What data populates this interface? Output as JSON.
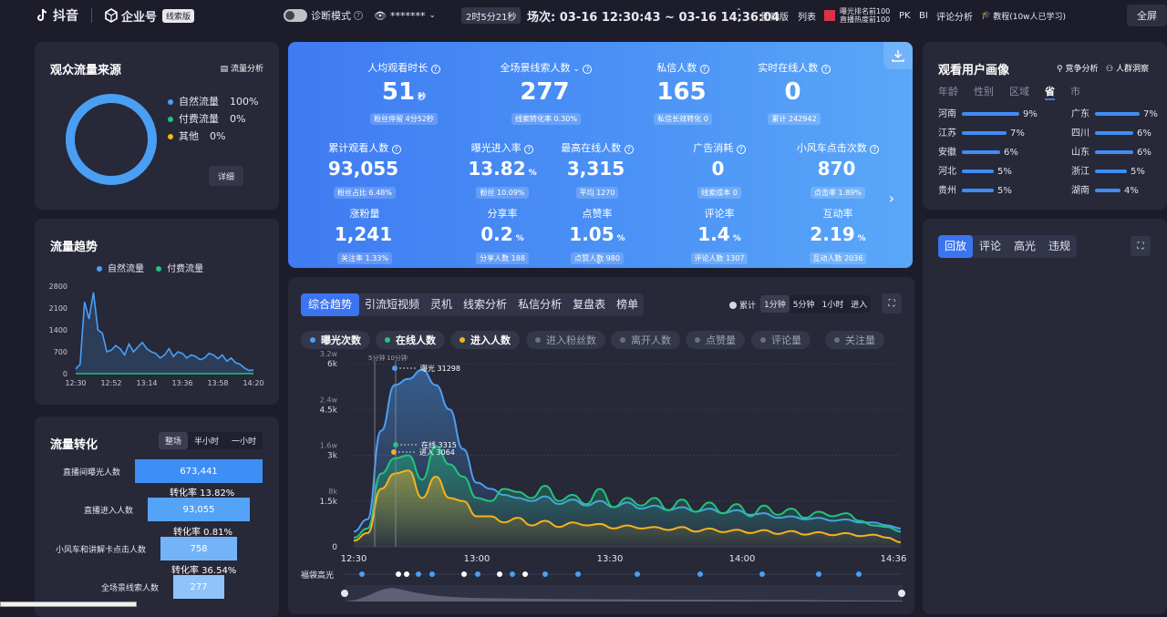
{
  "topbar": {
    "app_name": "抖音",
    "brand": "企业号",
    "badge": "线索版",
    "diag_label": "诊断模式",
    "masked": "*******",
    "duration": "2时5分21秒",
    "session": "场次: 03-16 12:30:43 ~ 03-16 14:36:04",
    "links": [
      "团购版",
      "列表"
    ],
    "ranking_line1": "曝光排名前100",
    "ranking_line2": "直播热度前100",
    "links2": [
      "PK",
      "BI",
      "评论分析"
    ],
    "tutorial": "教程(10w人已学习)",
    "fullscreen": "全屏"
  },
  "source": {
    "title": "观众流量来源",
    "link": "流量分析",
    "detail": "详细",
    "items": [
      {
        "name": "自然流量",
        "value": "100%",
        "color": "#4a9ff5"
      },
      {
        "name": "付费流量",
        "value": "0%",
        "color": "#22c37d"
      },
      {
        "name": "其他",
        "value": "0%",
        "color": "#f5b31e"
      }
    ]
  },
  "trend": {
    "title": "流量趋势",
    "legend": [
      "自然流量",
      "付费流量"
    ],
    "yticks": [
      "2800",
      "2100",
      "1400",
      "700",
      "0"
    ],
    "xticks": [
      "12:30",
      "12:52",
      "13:14",
      "13:36",
      "13:58",
      "14:20"
    ]
  },
  "funnel": {
    "title": "流量转化",
    "tabs": [
      "整场",
      "半小时",
      "一小时"
    ],
    "rows": [
      {
        "label": "直播间曝光人数",
        "value": "673,441"
      },
      {
        "label": "直播进入人数",
        "value": "93,055"
      },
      {
        "label": "小风车和讲解卡点击人数",
        "value": "758"
      },
      {
        "label": "全场景线索人数",
        "value": "277"
      }
    ],
    "rates": [
      "转化率 13.82%",
      "转化率 0.81%",
      "转化率 36.54%"
    ]
  },
  "kpi": {
    "row1": [
      {
        "label": "人均观看时长",
        "value": "51",
        "unit": "秒",
        "sub": "粉丝停留 4分52秒"
      },
      {
        "label": "全场景线索人数",
        "value": "277",
        "unit": "",
        "sub": "线索转化率 0.30%"
      },
      {
        "label": "私信人数",
        "value": "165",
        "unit": "",
        "sub": "私信长效转化 0"
      },
      {
        "label": "实时在线人数",
        "value": "0",
        "unit": "",
        "sub": "累计 242942"
      }
    ],
    "row2": [
      {
        "label": "累计观看人数",
        "value": "93,055",
        "unit": "",
        "sub": "粉丝占比 6.48%"
      },
      {
        "label": "曝光进入率",
        "value": "13.82",
        "unit": "%",
        "sub": "粉丝 10.09%"
      },
      {
        "label": "最高在线人数",
        "value": "3,315",
        "unit": "",
        "sub": "平均 1270"
      },
      {
        "label": "广告消耗",
        "value": "0",
        "unit": "",
        "sub": "线索成本 0"
      },
      {
        "label": "小风车点击次数",
        "value": "870",
        "unit": "",
        "sub": "点击率 1.89%"
      }
    ],
    "row3": [
      {
        "label": "涨粉量",
        "value": "1,241",
        "unit": "",
        "sub": "关注率 1.33%"
      },
      {
        "label": "分享率",
        "value": "0.2",
        "unit": "%",
        "sub": "分享人数 188"
      },
      {
        "label": "点赞率",
        "value": "1.05",
        "unit": "%",
        "sub": "点赞人数 980"
      },
      {
        "label": "评论率",
        "value": "1.4",
        "unit": "%",
        "sub": "评论人数 1307"
      },
      {
        "label": "互动率",
        "value": "2.19",
        "unit": "%",
        "sub": "互动人数 2036"
      }
    ]
  },
  "main": {
    "tabs": [
      "综合趋势",
      "引流短视频",
      "灵机",
      "线索分析",
      "私信分析",
      "复盘表",
      "榜单"
    ],
    "cum": "累计",
    "intervals": [
      "1分钟",
      "5分钟",
      "1小时",
      "进入"
    ],
    "chips_on": [
      {
        "name": "曝光次数",
        "color": "#4a9ff5"
      },
      {
        "name": "在线人数",
        "color": "#22c37d"
      },
      {
        "name": "进入人数",
        "color": "#f5b31e"
      }
    ],
    "chips_off": [
      "进入粉丝数",
      "离开人数",
      "点赞量",
      "评论量",
      "关注量"
    ],
    "ylabels_left": [
      "6k",
      "4.5k",
      "3k",
      "1.5k",
      "0"
    ],
    "ylabels_w": [
      "3.2w",
      "2.4w",
      "1.6w",
      "8k"
    ],
    "xticks": [
      "12:30",
      "13:00",
      "13:30",
      "14:00",
      "14:36"
    ],
    "marks": [
      "5分钟",
      "10分钟"
    ],
    "ann": [
      "曝光 31298",
      "在线 3315",
      "进入 3064"
    ],
    "bag": "福袋高光"
  },
  "portrait": {
    "title": "观看用户画像",
    "link1": "竞争分析",
    "link2": "人群洞察",
    "tabs": [
      "年龄",
      "性别",
      "区域",
      "省",
      "市"
    ],
    "left": [
      {
        "name": "河南",
        "value": "9%"
      },
      {
        "name": "江苏",
        "value": "7%"
      },
      {
        "name": "安徽",
        "value": "6%"
      },
      {
        "name": "河北",
        "value": "5%"
      },
      {
        "name": "贵州",
        "value": "5%"
      }
    ],
    "right": [
      {
        "name": "广东",
        "value": "7%"
      },
      {
        "name": "四川",
        "value": "6%"
      },
      {
        "name": "山东",
        "value": "6%"
      },
      {
        "name": "浙江",
        "value": "5%"
      },
      {
        "name": "湖南",
        "value": "4%"
      }
    ]
  },
  "replay": {
    "tabs": [
      "回放",
      "评论",
      "高光",
      "违规"
    ]
  },
  "chart_data": [
    {
      "type": "line",
      "title": "流量趋势",
      "series": [
        {
          "name": "自然流量",
          "values": [
            150,
            300,
            2300,
            1750,
            2600,
            1400,
            1300,
            700,
            750,
            900,
            800,
            600,
            950,
            700,
            850,
            1000,
            800,
            700,
            650,
            500,
            600,
            800,
            550,
            700,
            650,
            500,
            600,
            550,
            450,
            500,
            650,
            600,
            480,
            600,
            400,
            500,
            350,
            300,
            180,
            100,
            120
          ]
        },
        {
          "name": "付费流量",
          "values": [
            0,
            0,
            0,
            0,
            0,
            0,
            0,
            0,
            0,
            0,
            0,
            0,
            0,
            0,
            0,
            0,
            0,
            0,
            0,
            0,
            0,
            0,
            0,
            0,
            0,
            0,
            0,
            0,
            0,
            0,
            0,
            0,
            0,
            0,
            0,
            0,
            0,
            0,
            0,
            0,
            0
          ]
        }
      ],
      "ylim": [
        0,
        2800
      ]
    },
    {
      "type": "area",
      "title": "综合趋势",
      "series": [
        {
          "name": "曝光次数",
          "values": [
            500,
            900,
            3800,
            5300,
            5500,
            5800,
            5300,
            4500,
            3200,
            2100,
            1900,
            1700,
            1600,
            1500,
            1650,
            1400,
            1550,
            1350,
            1500,
            1300,
            1450,
            1250,
            1350,
            1200,
            1300,
            1150,
            1250,
            1100,
            1200,
            1050,
            1100,
            950,
            1000,
            900,
            950,
            850,
            900,
            800,
            800,
            700,
            600
          ]
        },
        {
          "name": "在线人数",
          "values": [
            300,
            600,
            2400,
            2900,
            3000,
            2200,
            3300,
            2700,
            2300,
            1600,
            1500,
            1900,
            1800,
            1600,
            2000,
            1500,
            1700,
            1400,
            1900,
            1300,
            1600,
            1350,
            1600,
            1200,
            1550,
            1150,
            1450,
            1100,
            1400,
            1000,
            1350,
            1050,
            1250,
            950,
            1150,
            1000,
            1100,
            850,
            700,
            650,
            500
          ]
        },
        {
          "name": "进入人数",
          "values": [
            200,
            450,
            1900,
            2400,
            2500,
            1600,
            2300,
            1600,
            1500,
            1000,
            1000,
            800,
            950,
            700,
            850,
            650,
            800,
            700,
            750,
            600,
            700,
            600,
            650,
            550,
            650,
            500,
            600,
            480,
            560,
            450,
            550,
            420,
            520,
            400,
            480,
            380,
            450,
            350,
            400,
            300,
            150
          ]
        }
      ],
      "ylim": [
        0,
        6000
      ],
      "xticks": [
        "12:30",
        "13:00",
        "13:30",
        "14:00",
        "14:36"
      ]
    }
  ]
}
